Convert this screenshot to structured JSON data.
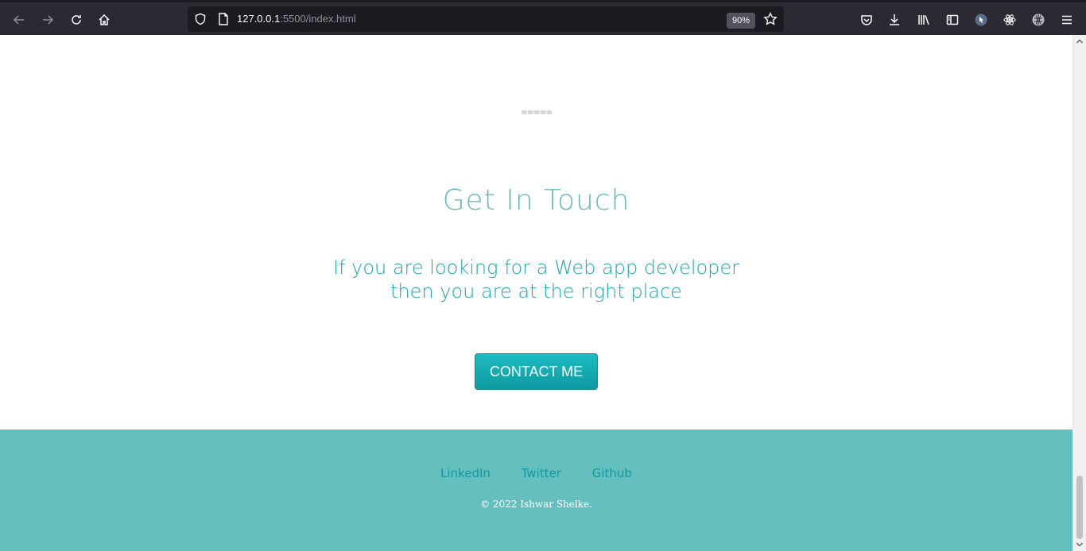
{
  "browser": {
    "url_host": "127.0.0.1",
    "url_rest": ":5500/index.html",
    "zoom": "90%"
  },
  "main": {
    "heading": "Get In Touch",
    "tagline_line1": "If you are looking for a Web app developer",
    "tagline_line2": "then you are at the right place",
    "contact_button": "CONTACT ME"
  },
  "footer": {
    "links": [
      "LinkedIn",
      "Twitter",
      "Github"
    ],
    "copyright": "© 2022 Ishwar Shelke."
  }
}
